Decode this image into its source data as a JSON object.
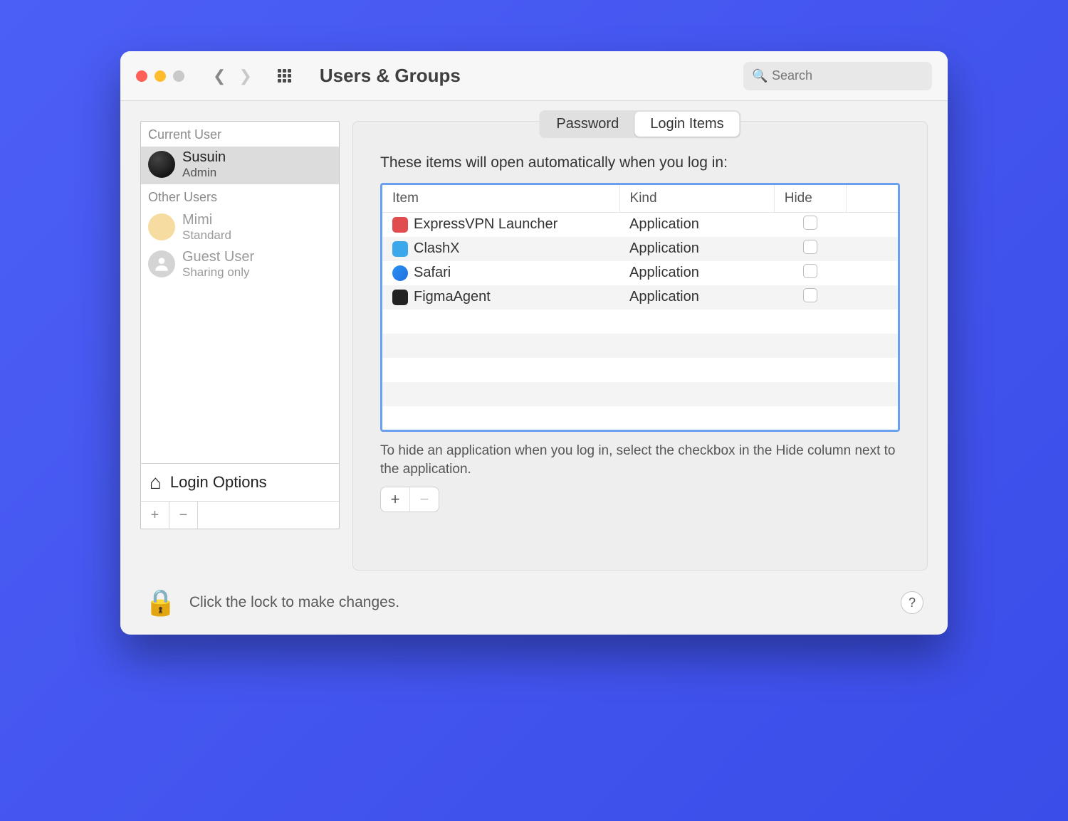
{
  "window": {
    "title": "Users & Groups",
    "search_placeholder": "Search"
  },
  "sidebar": {
    "current_user_label": "Current User",
    "other_users_label": "Other Users",
    "users": [
      {
        "name": "Susuin",
        "role": "Admin"
      },
      {
        "name": "Mimi",
        "role": "Standard"
      },
      {
        "name": "Guest User",
        "role": "Sharing only"
      }
    ],
    "login_options_label": "Login Options"
  },
  "tabs": {
    "password": "Password",
    "login_items": "Login Items"
  },
  "panel": {
    "heading": "These items will open automatically when you log in:",
    "columns": {
      "item": "Item",
      "kind": "Kind",
      "hide": "Hide"
    },
    "items": [
      {
        "name": "ExpressVPN Launcher",
        "kind": "Application",
        "hide": false,
        "icon": "red"
      },
      {
        "name": "ClashX",
        "kind": "Application",
        "hide": false,
        "icon": "cyan"
      },
      {
        "name": "Safari",
        "kind": "Application",
        "hide": false,
        "icon": "blue"
      },
      {
        "name": "FigmaAgent",
        "kind": "Application",
        "hide": false,
        "icon": "dark"
      }
    ],
    "hint": "To hide an application when you log in, select the checkbox in the Hide column next to the application."
  },
  "footer": {
    "lock_text": "Click the lock to make changes."
  }
}
